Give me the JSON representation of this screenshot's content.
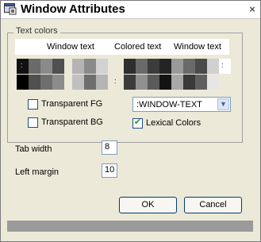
{
  "window": {
    "title": "Window Attributes",
    "close_glyph": "×"
  },
  "text_colors": {
    "group_label": "Text colors",
    "headers": [
      "Window text",
      "Colored text",
      "Window text"
    ],
    "swatch_marks": [
      ":",
      ":",
      ":"
    ]
  },
  "checkboxes": {
    "transparent_fg": {
      "label": "Transparent FG",
      "checked": false
    },
    "transparent_bg": {
      "label": "Transparent BG",
      "checked": false
    },
    "lexical_colors": {
      "label": "Lexical Colors",
      "checked": true,
      "tick": "✔"
    }
  },
  "text_select": {
    "value": ":WINDOW-TEXT",
    "arrow": "▼"
  },
  "fields": {
    "tab_width": {
      "label": "Tab width",
      "value": "8"
    },
    "left_margin": {
      "label": "Left margin",
      "value": "10"
    }
  },
  "buttons": {
    "ok": "OK",
    "cancel": "Cancel"
  },
  "icons": {
    "title": "window-app-icon",
    "close": "close-icon",
    "dropdown": "chevron-down-icon"
  }
}
